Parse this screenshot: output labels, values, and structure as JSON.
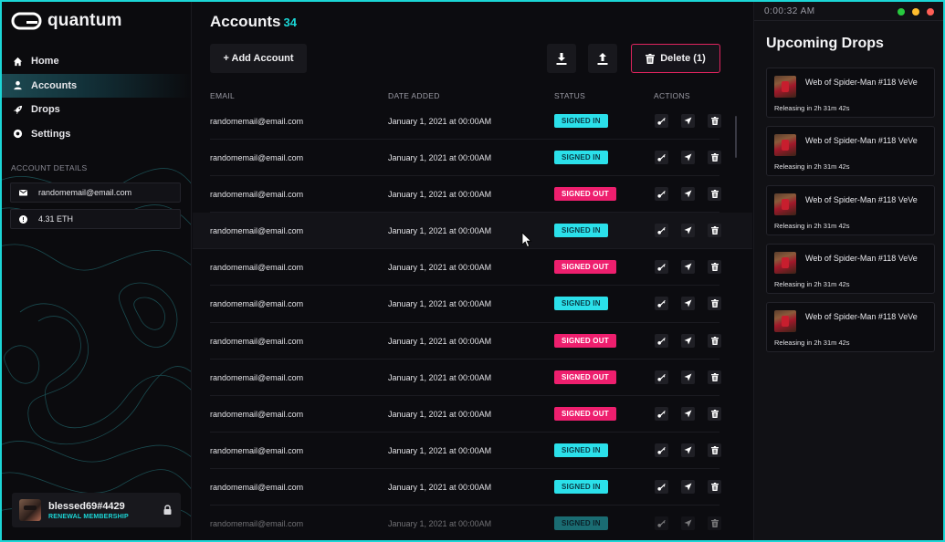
{
  "app": {
    "name": "quantum"
  },
  "nav": [
    {
      "label": "Home",
      "icon": "home-icon"
    },
    {
      "label": "Accounts",
      "icon": "user-icon"
    },
    {
      "label": "Drops",
      "icon": "rocket-icon"
    },
    {
      "label": "Settings",
      "icon": "gear-icon"
    }
  ],
  "account_details": {
    "heading": "ACCOUNT DETAILS",
    "email": "randomemail@email.com",
    "balance": "4.31 ETH"
  },
  "user": {
    "name": "blessed69#4429",
    "membership": "RENEWAL MEMBERSHIP"
  },
  "main": {
    "title": "Accounts",
    "count": "34",
    "add_label": "+ Add Account",
    "delete_label": "Delete (1)",
    "columns": {
      "email": "EMAIL",
      "date": "DATE ADDED",
      "status": "STATUS",
      "actions": "ACTIONS"
    },
    "rows": [
      {
        "email": "randomemail@email.com",
        "date": "January 1, 2021 at 00:00AM",
        "status": "SIGNED IN"
      },
      {
        "email": "randomemail@email.com",
        "date": "January 1, 2021 at 00:00AM",
        "status": "SIGNED IN"
      },
      {
        "email": "randomemail@email.com",
        "date": "January 1, 2021 at 00:00AM",
        "status": "SIGNED OUT"
      },
      {
        "email": "randomemail@email.com",
        "date": "January 1, 2021 at 00:00AM",
        "status": "SIGNED IN"
      },
      {
        "email": "randomemail@email.com",
        "date": "January 1, 2021 at 00:00AM",
        "status": "SIGNED OUT"
      },
      {
        "email": "randomemail@email.com",
        "date": "January 1, 2021 at 00:00AM",
        "status": "SIGNED IN"
      },
      {
        "email": "randomemail@email.com",
        "date": "January 1, 2021 at 00:00AM",
        "status": "SIGNED OUT"
      },
      {
        "email": "randomemail@email.com",
        "date": "January 1, 2021 at 00:00AM",
        "status": "SIGNED OUT"
      },
      {
        "email": "randomemail@email.com",
        "date": "January 1, 2021 at 00:00AM",
        "status": "SIGNED OUT"
      },
      {
        "email": "randomemail@email.com",
        "date": "January 1, 2021 at 00:00AM",
        "status": "SIGNED IN"
      },
      {
        "email": "randomemail@email.com",
        "date": "January 1, 2021 at 00:00AM",
        "status": "SIGNED IN"
      },
      {
        "email": "randomemail@email.com",
        "date": "January 1, 2021 at 00:00AM",
        "status": "SIGNED IN"
      }
    ]
  },
  "right": {
    "timer": "0:00:32 AM",
    "title": "Upcoming Drops",
    "drops": [
      {
        "name": "Web of Spider-Man #118 VeVe",
        "release": "Releasing in 2h 31m 42s"
      },
      {
        "name": "Web of Spider-Man #118 VeVe",
        "release": "Releasing in 2h 31m 42s"
      },
      {
        "name": "Web of Spider-Man #118 VeVe",
        "release": "Releasing in 2h 31m 42s"
      },
      {
        "name": "Web of Spider-Man #118 VeVe",
        "release": "Releasing in 2h 31m 42s"
      },
      {
        "name": "Web of Spider-Man #118 VeVe",
        "release": "Releasing in 2h 31m 42s"
      }
    ]
  },
  "colors": {
    "accent": "#1bd6d6",
    "signed_in": "#2be0ea",
    "signed_out": "#ee1f6e",
    "dot_green": "#27c93f",
    "dot_yellow": "#ffbd2e",
    "dot_red": "#ff5f56"
  }
}
